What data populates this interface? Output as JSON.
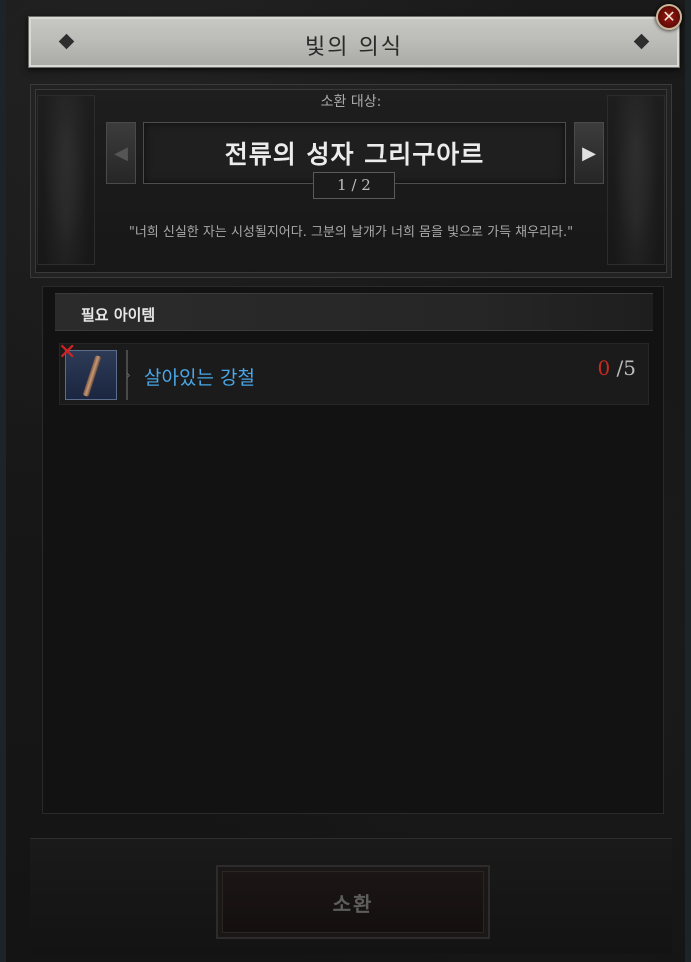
{
  "window": {
    "title": "빛의 의식",
    "close_icon": "close-icon"
  },
  "summon_target": {
    "label": "소환 대상:",
    "name": "전류의 성자 그리구아르",
    "page": "1 / 2",
    "quote": "\"너희 신실한 자는 시성될지어다. 그분의 날개가 너희 몸을 빛으로 가득 채우리라.\"",
    "prev_icon": "arrow-left-icon",
    "next_icon": "arrow-right-icon"
  },
  "required_items": {
    "header": "필요 아이템",
    "items": [
      {
        "name": "살아있는 강철",
        "have": "0",
        "need": "/5",
        "icon": "living-steel-icon",
        "status_icon": "x-mark-icon"
      }
    ]
  },
  "actions": {
    "summon_label": "소환"
  },
  "colors": {
    "item_name": "#4aa6e6",
    "count_missing": "#c42a22",
    "close_button": "#9b1a12"
  }
}
